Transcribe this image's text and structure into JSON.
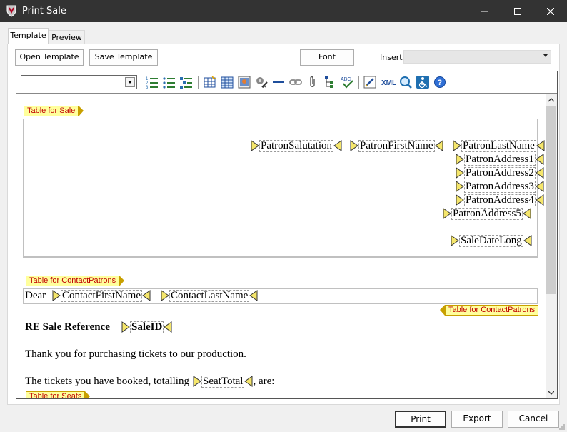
{
  "window": {
    "title": "Print Sale"
  },
  "tabs": [
    {
      "label": "Template"
    },
    {
      "label": "Preview"
    }
  ],
  "toolbar_top": {
    "open_template": "Open Template",
    "save_template": "Save Template",
    "font": "Font",
    "insert_label": "Insert",
    "insert_value": ""
  },
  "editor_toolbar": {
    "style_value": "",
    "icons": [
      "numbered-list-icon",
      "bullet-list-icon",
      "indent-list-icon",
      "table-insert-icon",
      "table-grid-icon",
      "image-icon",
      "image-edit-icon",
      "horizontal-rule-icon",
      "link-icon",
      "attachment-icon",
      "tree-icon",
      "spellcheck-icon",
      "edit-source-icon",
      "xml-icon",
      "preview-icon",
      "accessibility-icon",
      "help-icon"
    ],
    "xml_text": "XML"
  },
  "document": {
    "table_sale_label": "Table for Sale",
    "fields": {
      "salutation": "PatronSalutation",
      "first_name": "PatronFirstName",
      "last_name": "PatronLastName",
      "address1": "PatronAddress1",
      "address2": "PatronAddress2",
      "address3": "PatronAddress3",
      "address4": "PatronAddress4",
      "address5": "PatronAddress5",
      "sale_date": "SaleDateLong"
    },
    "table_contact_label": "Table for ContactPatrons",
    "dear": "Dear",
    "contact_first": "ContactFirstName",
    "contact_last": "ContactLastName",
    "table_contact_end_label": "Table for ContactPatrons",
    "re_text": "RE Sale Reference",
    "sale_id": "SaleID",
    "thanks": "Thank you for purchasing tickets to our production.",
    "booked_prefix": "The tickets you have booked, totalling",
    "seat_total": "SeatTotal",
    "booked_suffix": ", are:",
    "table_seats_label": "Table for Seats"
  },
  "buttons": {
    "print": "Print",
    "export": "Export",
    "cancel": "Cancel"
  },
  "colors": {
    "titlebar": "#333333",
    "tag_fill": "#ffff9c",
    "tag_text": "#c00000",
    "marker_fill": "#f5e66b"
  }
}
